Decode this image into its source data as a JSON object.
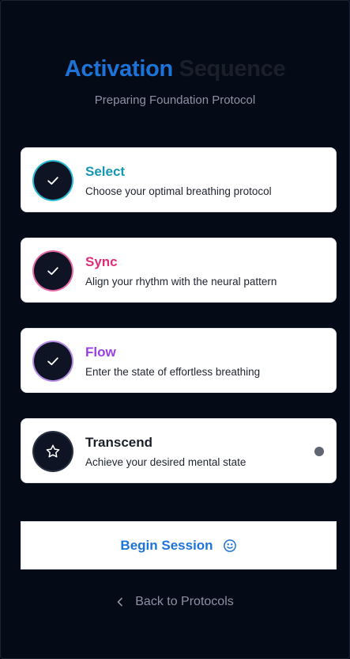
{
  "header": {
    "title_word1": "Activation",
    "title_word2": "Sequence",
    "subtitle": "Preparing Foundation Protocol"
  },
  "steps": [
    {
      "title": "Select",
      "description": "Choose your optimal breathing protocol",
      "status": "completed",
      "icon": "check-icon",
      "color": "#1596b3"
    },
    {
      "title": "Sync",
      "description": "Align your rhythm with the neural pattern",
      "status": "completed",
      "icon": "check-icon",
      "color": "#de2d7a"
    },
    {
      "title": "Flow",
      "description": "Enter the state of effortless breathing",
      "status": "completed",
      "icon": "check-icon",
      "color": "#9a3fe0"
    },
    {
      "title": "Transcend",
      "description": "Achieve your desired mental state",
      "status": "current",
      "icon": "star-icon",
      "color": "#1b1f29"
    }
  ],
  "actions": {
    "begin_label": "Begin Session",
    "begin_icon": "smiley-icon",
    "back_label": "Back to Protocols",
    "back_icon": "chevron-left-icon"
  },
  "colors": {
    "accent": "#1d74d8",
    "background": "#050a17"
  }
}
